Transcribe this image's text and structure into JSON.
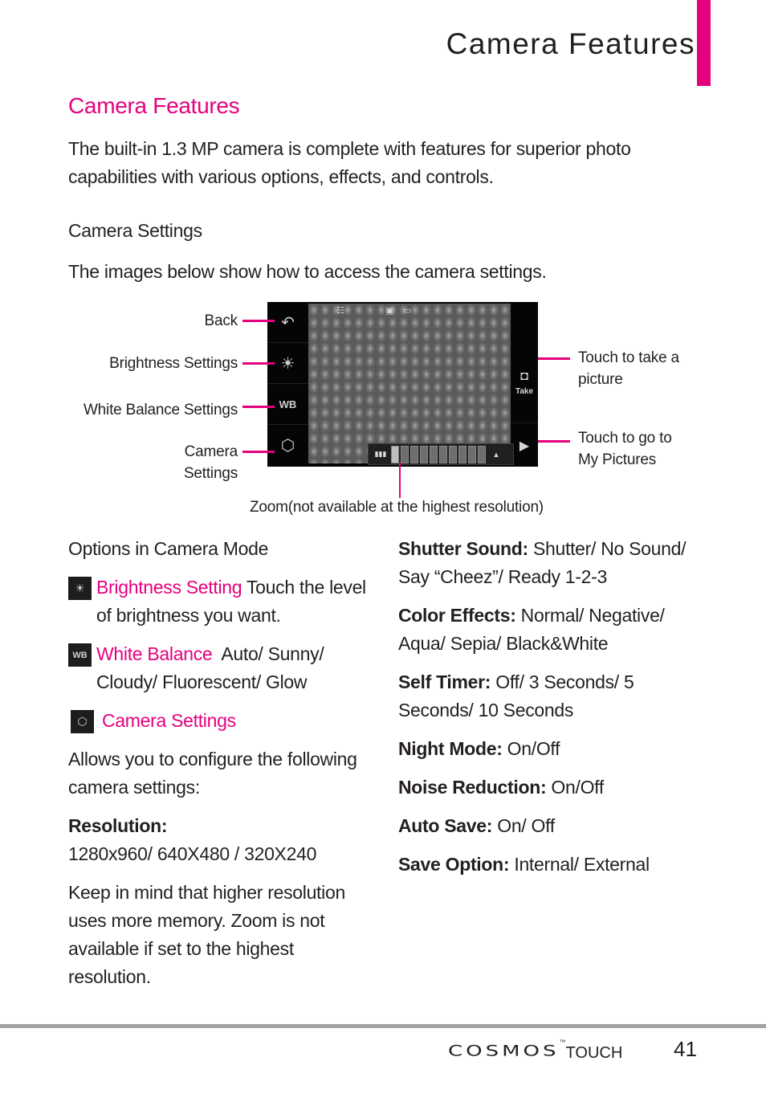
{
  "header": {
    "page_title": "Camera Features",
    "accent_color": "#e5007e"
  },
  "section": {
    "title": "Camera Features",
    "intro": "The built-in 1.3 MP camera is complete with features for superior photo capabilities with various options, effects, and controls.",
    "subtitle": "Camera Settings",
    "subtext": "The images below show how to access the camera settings."
  },
  "diagram": {
    "left_callouts": [
      {
        "label": "Back",
        "icon": "back-arrow-icon"
      },
      {
        "label": "Brightness Settings",
        "icon": "brightness-icon"
      },
      {
        "label": "White Balance Settings",
        "icon": "white-balance-icon"
      },
      {
        "label": "Camera\nSettings",
        "icon": "gear-icon"
      }
    ],
    "right_callouts": [
      {
        "label": "Touch to take a\npicture",
        "icon": "camera-icon"
      },
      {
        "label": "Touch to go to\nMy Pictures",
        "icon": "play-icon"
      }
    ],
    "take_button_label": "Take",
    "wb_icon_text": "WB",
    "zoom_callout": "Zoom(not available at the highest resolution)",
    "zoom_level_segments": 10
  },
  "options": {
    "heading": "Options in Camera Mode",
    "brightness": {
      "label": "Brightness Setting",
      "desc": " Touch the level of brightness you want."
    },
    "white_balance": {
      "label": "White Balance",
      "desc": "  Auto/ Sunny/ Cloudy/ Fluorescent/ Glow",
      "icon_text": "WB"
    },
    "camera_settings": {
      "label": "Camera Settings"
    },
    "allows_text": "Allows you to configure the following  camera settings:",
    "resolution_label": "Resolution:",
    "resolution_values": "1280x960/ 640X480 / 320X240",
    "resolution_note": "Keep in mind that higher resolution uses more memory. Zoom is not available if set to the highest resolution."
  },
  "settings": [
    {
      "label": "Shutter Sound:",
      "value": " Shutter/ No Sound/ Say “Cheez”/ Ready 1-2-3"
    },
    {
      "label": "Color Effects:",
      "value": " Normal/ Negative/ Aqua/ Sepia/ Black&White"
    },
    {
      "label": "Self Timer:",
      "value": " Off/ 3 Seconds/ 5 Seconds/ 10 Seconds"
    },
    {
      "label": "Night Mode:",
      "value": " On/Off"
    },
    {
      "label": "Noise Reduction:",
      "value": " On/Off"
    },
    {
      "label": "Auto Save:",
      "value": " On/ Off"
    },
    {
      "label": "Save Option:",
      "value": " Internal/ External"
    }
  ],
  "footer": {
    "brand": "COSMOS",
    "trademark": "™",
    "product": "TOUCH",
    "page_number": "41"
  }
}
